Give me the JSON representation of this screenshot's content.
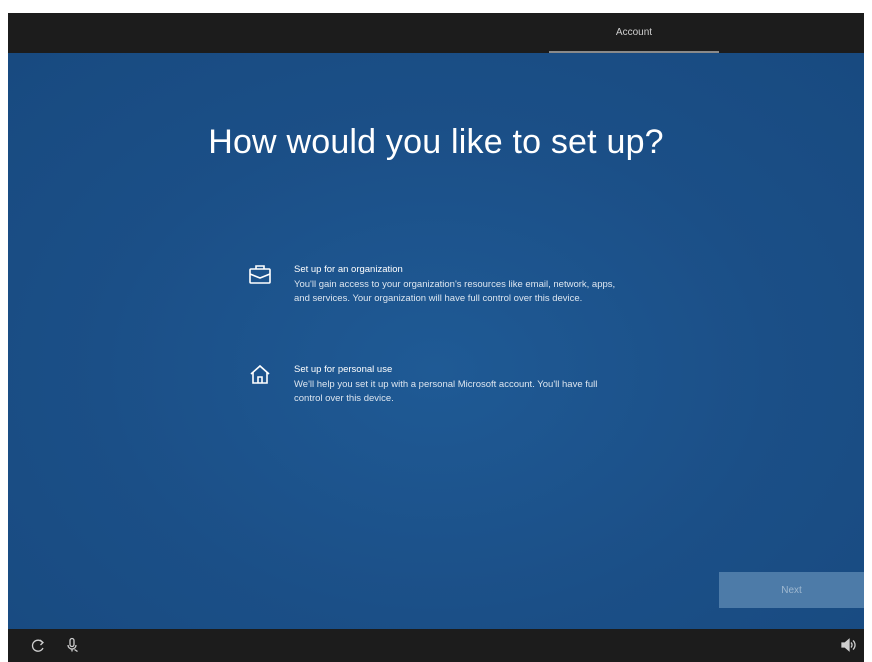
{
  "header": {
    "active_tab": "Account"
  },
  "main": {
    "title": "How would you like to set up?",
    "options": [
      {
        "icon": "briefcase-icon",
        "title": "Set up for an organization",
        "description": "You'll gain access to your organization's resources like email, network, apps, and services. Your organization will have full control over this device."
      },
      {
        "icon": "home-icon",
        "title": "Set up for personal use",
        "description": "We'll help you set it up with a personal Microsoft account. You'll have full control over this device."
      }
    ],
    "next_label": "Next"
  },
  "taskbar": {
    "left_icons": [
      "ease-of-access-icon",
      "microphone-icon"
    ],
    "right_icons": [
      "volume-icon"
    ]
  },
  "colors": {
    "background_blue": "#1b4f87",
    "bar_dark": "#1c1c1c",
    "button_disabled": "#4d7ba8",
    "text_white": "#ffffff"
  }
}
